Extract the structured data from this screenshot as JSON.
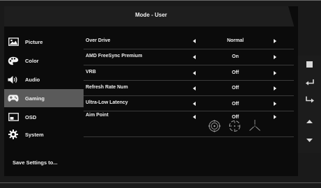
{
  "header": {
    "title": "Mode - User"
  },
  "sidebar": {
    "items": [
      {
        "label": "Picture",
        "icon": "picture-icon"
      },
      {
        "label": "Color",
        "icon": "palette-icon"
      },
      {
        "label": "Audio",
        "icon": "speaker-icon"
      },
      {
        "label": "Gaming",
        "icon": "gamepad-icon",
        "active": true
      },
      {
        "label": "OSD",
        "icon": "osd-icon"
      },
      {
        "label": "System",
        "icon": "gear-icon"
      }
    ],
    "save_label": "Save Settings to..."
  },
  "settings": [
    {
      "label": "Over Drive",
      "value": "Normal"
    },
    {
      "label": "AMD FreeSync Premium",
      "value": "On"
    },
    {
      "label": "VRB",
      "value": "Off"
    },
    {
      "label": "Refresh Rate Num",
      "value": "Off"
    },
    {
      "label": "Ultra-Low Latency",
      "value": "Off"
    },
    {
      "label": "Aim Point",
      "value": "Off"
    }
  ],
  "aim_point_styles": [
    "crosshair-circle-icon",
    "crosshair-dashed-icon",
    "crosshair-lines-icon"
  ],
  "hotkeys": [
    "stop-square-icon",
    "return-icon",
    "enter-icon",
    "up-arrow-icon",
    "down-arrow-icon"
  ],
  "colors": {
    "background": "#0b0b0b",
    "header": "#1e1e1e",
    "active_item": "#5a5a5a",
    "text": "#f0f0f0"
  }
}
